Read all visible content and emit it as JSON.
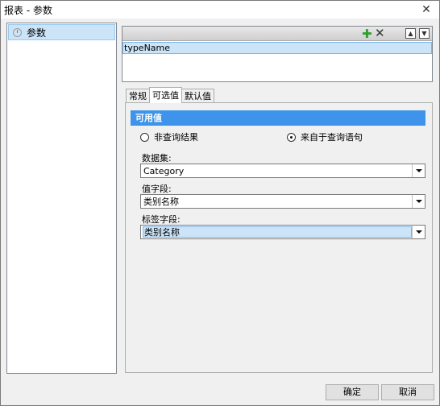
{
  "window": {
    "title": "报表 - 参数"
  },
  "tree": {
    "items": [
      {
        "label": "参数"
      }
    ]
  },
  "param_list": {
    "rows": [
      {
        "name": "typeName"
      }
    ]
  },
  "tabs": [
    {
      "label": "常规"
    },
    {
      "label": "可选值"
    },
    {
      "label": "默认值"
    }
  ],
  "panel": {
    "header": "可用值",
    "radio_options": [
      {
        "label": "非查询结果",
        "checked": false
      },
      {
        "label": "来自于查询语句",
        "checked": true
      }
    ],
    "dataset": {
      "label": "数据集:",
      "value": "Category"
    },
    "value_field": {
      "label": "值字段:",
      "value": "类别名称"
    },
    "label_field": {
      "label": "标签字段:",
      "value": "类别名称"
    }
  },
  "buttons": {
    "ok": "确定",
    "cancel": "取消"
  },
  "colors": {
    "accent": "#3d94ea",
    "selection": "#cce4f7",
    "add": "#2ea02e"
  }
}
